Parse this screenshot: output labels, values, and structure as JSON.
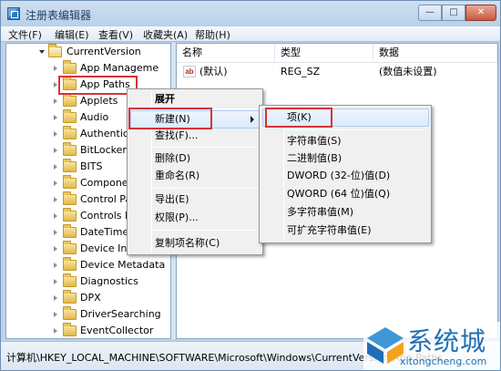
{
  "window": {
    "title": "注册表编辑器"
  },
  "window_controls": {
    "minimize": "—",
    "maximize": "□",
    "close": "✕"
  },
  "menubar": [
    {
      "label": "文件(F)"
    },
    {
      "label": "编辑(E)"
    },
    {
      "label": "查看(V)"
    },
    {
      "label": "收藏夹(A)"
    },
    {
      "label": "帮助(H)"
    }
  ],
  "tree": {
    "parent": "CurrentVersion",
    "items": [
      {
        "label": "App Manageme"
      },
      {
        "label": "App Paths",
        "selected": true
      },
      {
        "label": "Applets"
      },
      {
        "label": "Audio"
      },
      {
        "label": "Authentica"
      },
      {
        "label": "BitLocker"
      },
      {
        "label": "BITS"
      },
      {
        "label": "Compone"
      },
      {
        "label": "Control Pa"
      },
      {
        "label": "Controls F"
      },
      {
        "label": "DateTime"
      },
      {
        "label": "Device Ins"
      },
      {
        "label": "Device Metadata"
      },
      {
        "label": "Diagnostics"
      },
      {
        "label": "DPX"
      },
      {
        "label": "DriverSearching"
      },
      {
        "label": "EventCollector"
      }
    ]
  },
  "values_pane": {
    "columns": [
      "名称",
      "类型",
      "数据"
    ],
    "rows": [
      {
        "icon": "ab-string-icon",
        "icon_text": "ab",
        "name": "(默认)",
        "type": "REG_SZ",
        "data": "(数值未设置)"
      }
    ]
  },
  "context_menu": {
    "items": [
      {
        "label": "展开",
        "bold": true
      },
      {
        "label": "新建(N)",
        "has_submenu": true,
        "hovered": true
      },
      {
        "label": "查找(F)..."
      },
      {
        "label": "删除(D)"
      },
      {
        "label": "重命名(R)"
      },
      {
        "label": "导出(E)"
      },
      {
        "label": "权限(P)..."
      },
      {
        "label": "复制项名称(C)"
      }
    ]
  },
  "submenu": {
    "items": [
      {
        "label": "项(K)",
        "hovered": true
      },
      {
        "label": "字符串值(S)"
      },
      {
        "label": "二进制值(B)"
      },
      {
        "label": "DWORD (32-位)值(D)"
      },
      {
        "label": "QWORD (64 位)值(Q)"
      },
      {
        "label": "多字符串值(M)"
      },
      {
        "label": "可扩充字符串值(E)"
      }
    ]
  },
  "statusbar": {
    "path": "计算机\\HKEY_LOCAL_MACHINE\\SOFTWARE\\Microsoft\\Windows\\CurrentVersion\\App Paths"
  },
  "watermark": {
    "title": "系统城",
    "url": "xitongcheng.com"
  },
  "colors": {
    "highlight_red": "#d9323a",
    "accent_blue": "#1e6fb5"
  }
}
